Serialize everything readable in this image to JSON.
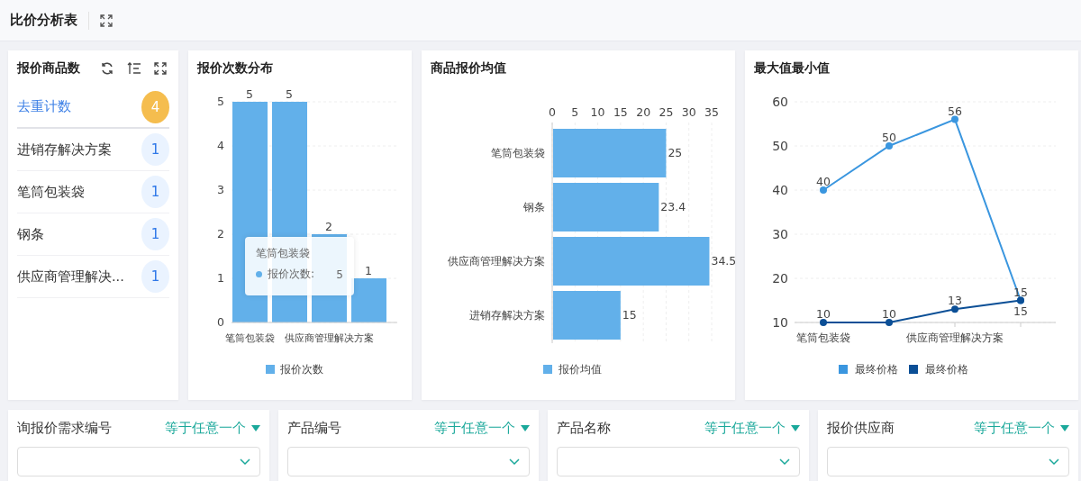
{
  "header": {
    "title": "比价分析表"
  },
  "count_card": {
    "title": "报价商品数",
    "items": [
      {
        "name": "去重计数",
        "count": "4",
        "selected": true
      },
      {
        "name": "进销存解决方案",
        "count": "1",
        "selected": false
      },
      {
        "name": "笔筒包装袋",
        "count": "1",
        "selected": false
      },
      {
        "name": "钢条",
        "count": "1",
        "selected": false
      },
      {
        "name": "供应商管理解决...",
        "count": "1",
        "selected": false
      }
    ]
  },
  "distribution_card": {
    "title": "报价次数分布",
    "chart_data": {
      "type": "bar",
      "categories": [
        "笔筒包装袋",
        null,
        "供应商管理解决方案",
        null
      ],
      "series": [
        {
          "name": "报价次数",
          "color": "#62b0ea",
          "values": [
            5,
            5,
            2,
            1
          ]
        }
      ],
      "ylim": [
        0,
        5
      ],
      "yticks": [
        0,
        1,
        2,
        3,
        4,
        5
      ],
      "data_labels": true,
      "grid": true
    },
    "tooltip": {
      "title": "笔筒包装袋",
      "label": "报价次数:",
      "value": "5"
    }
  },
  "average_card": {
    "title": "商品报价均值",
    "chart_data": {
      "type": "bar",
      "orientation": "horizontal",
      "categories": [
        "笔筒包装袋",
        "钢条",
        "供应商管理解决方案",
        "进销存解决方案"
      ],
      "series": [
        {
          "name": "报价均值",
          "color": "#62b0ea",
          "values": [
            25,
            23.4,
            34.5,
            15
          ]
        }
      ],
      "xlim": [
        0,
        35
      ],
      "xticks": [
        0,
        5,
        10,
        15,
        20,
        25,
        30,
        35
      ],
      "data_labels": true,
      "grid": true
    }
  },
  "minmax_card": {
    "title": "最大值最小值",
    "chart_data": {
      "type": "line",
      "categories": [
        "笔筒包装袋",
        null,
        "供应商管理解决方案",
        null
      ],
      "series": [
        {
          "name": "最终价格",
          "color": "#3a96df",
          "values": [
            40,
            50,
            56,
            15
          ],
          "marker": "circle"
        },
        {
          "name": "最终价格",
          "color": "#0b4f96",
          "values": [
            10,
            10,
            13,
            15
          ],
          "marker": "circle"
        }
      ],
      "ylim": [
        10,
        60
      ],
      "yticks": [
        10,
        20,
        30,
        40,
        50,
        60
      ],
      "data_labels": true,
      "grid": true
    }
  },
  "filters": [
    {
      "label": "询报价需求编号",
      "operator": "等于任意一个"
    },
    {
      "label": "产品编号",
      "operator": "等于任意一个"
    },
    {
      "label": "产品名称",
      "operator": "等于任意一个"
    },
    {
      "label": "报价供应商",
      "operator": "等于任意一个"
    }
  ]
}
